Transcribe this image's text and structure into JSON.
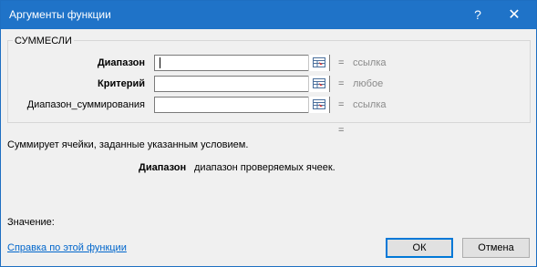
{
  "window": {
    "title": "Аргументы функции",
    "help_button": "?",
    "close_button": "✕"
  },
  "function_name": "СУММЕСЛИ",
  "arguments": [
    {
      "label": "Диапазон",
      "value": "",
      "equals": "=",
      "result": "ссылка",
      "bold": true
    },
    {
      "label": "Критерий",
      "value": "",
      "equals": "=",
      "result": "любое",
      "bold": true
    },
    {
      "label": "Диапазон_суммирования",
      "value": "",
      "equals": "=",
      "result": "ссылка",
      "bold": false
    }
  ],
  "total_equals": "=",
  "description": "Суммирует ячейки, заданные указанным условием.",
  "argument_help": {
    "name": "Диапазон",
    "text": "диапазон проверяемых ячеек."
  },
  "value_label": "Значение:",
  "help_link": "Справка по этой функции",
  "buttons": {
    "ok": "ОК",
    "cancel": "Отмена"
  }
}
